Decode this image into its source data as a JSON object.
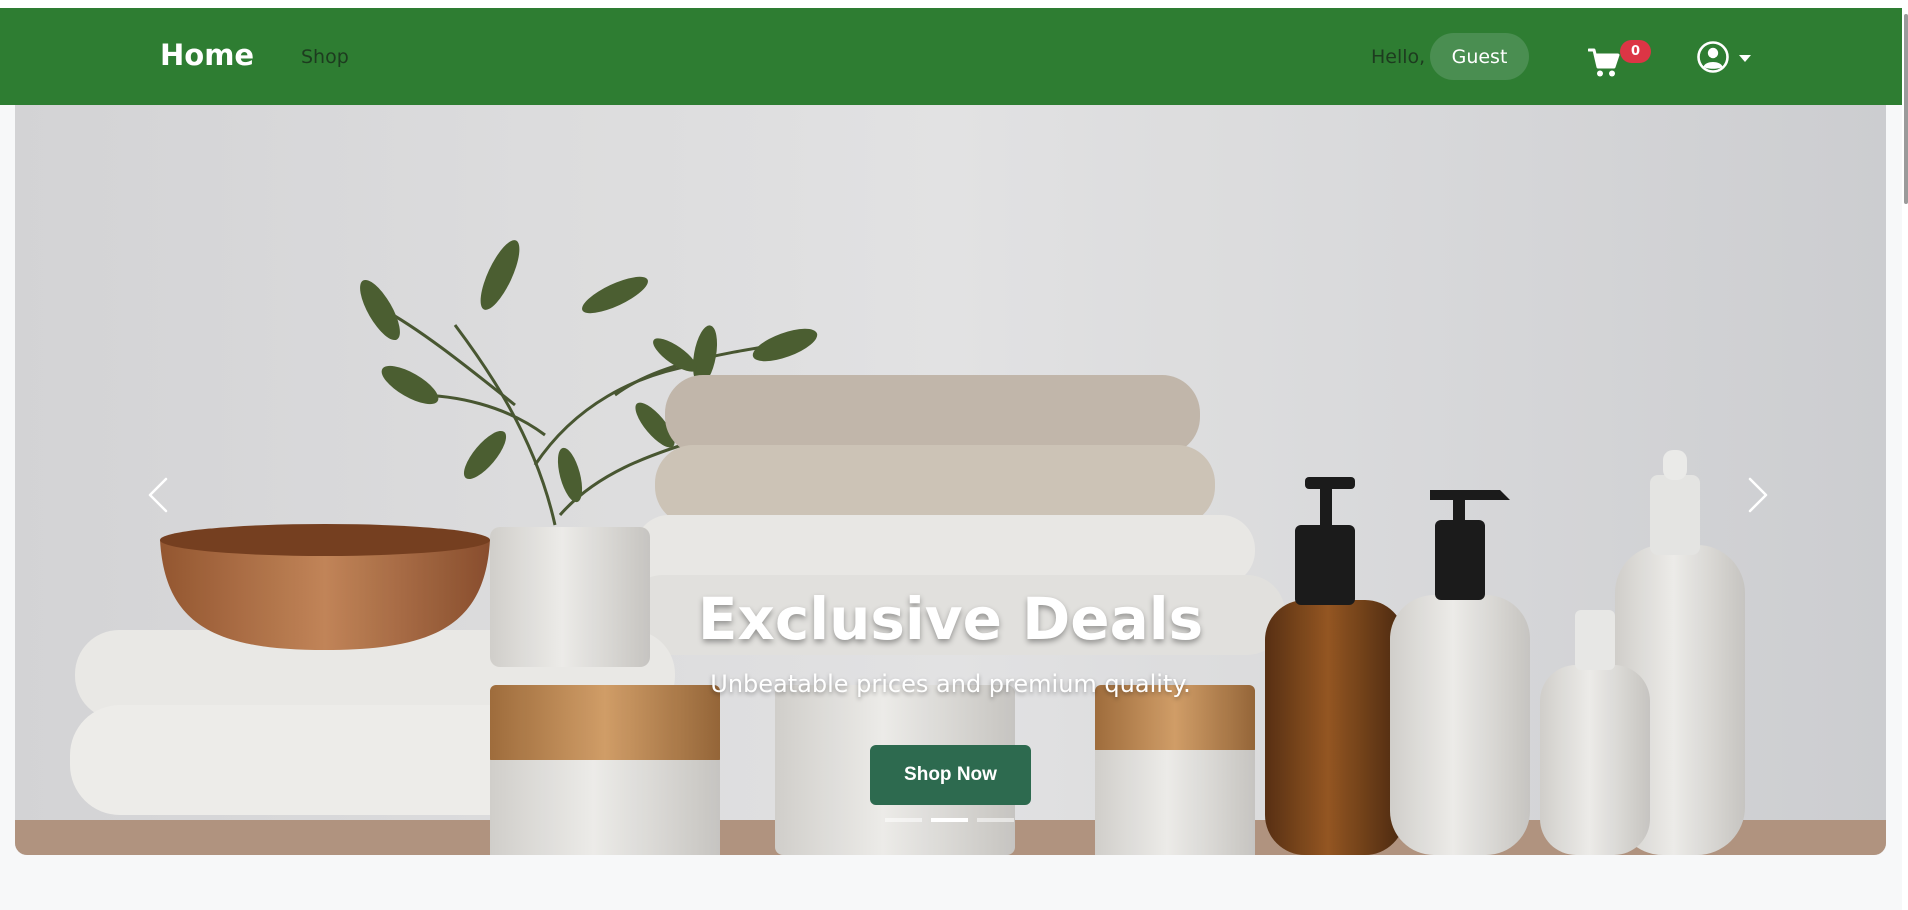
{
  "navbar": {
    "brand": "Home",
    "links": [
      {
        "label": "Shop"
      }
    ],
    "greeting": "Hello,",
    "user_name": "Guest",
    "cart_count": "0",
    "icons": {
      "cart": "cart-icon",
      "user": "user-circle-icon",
      "caret": "caret-down-icon"
    },
    "colors": {
      "navbar_bg": "#2e7d32",
      "badge": "#dc3545",
      "pill": "#4a8e51"
    }
  },
  "hero": {
    "title": "Exclusive Deals",
    "subtitle": "Unbeatable prices and premium quality.",
    "cta_label": "Shop Now",
    "slide_count": 3,
    "active_slide": 2,
    "icons": {
      "prev": "chevron-left-icon",
      "next": "chevron-right-icon"
    },
    "colors": {
      "cta_bg": "#2d6a4f"
    }
  }
}
